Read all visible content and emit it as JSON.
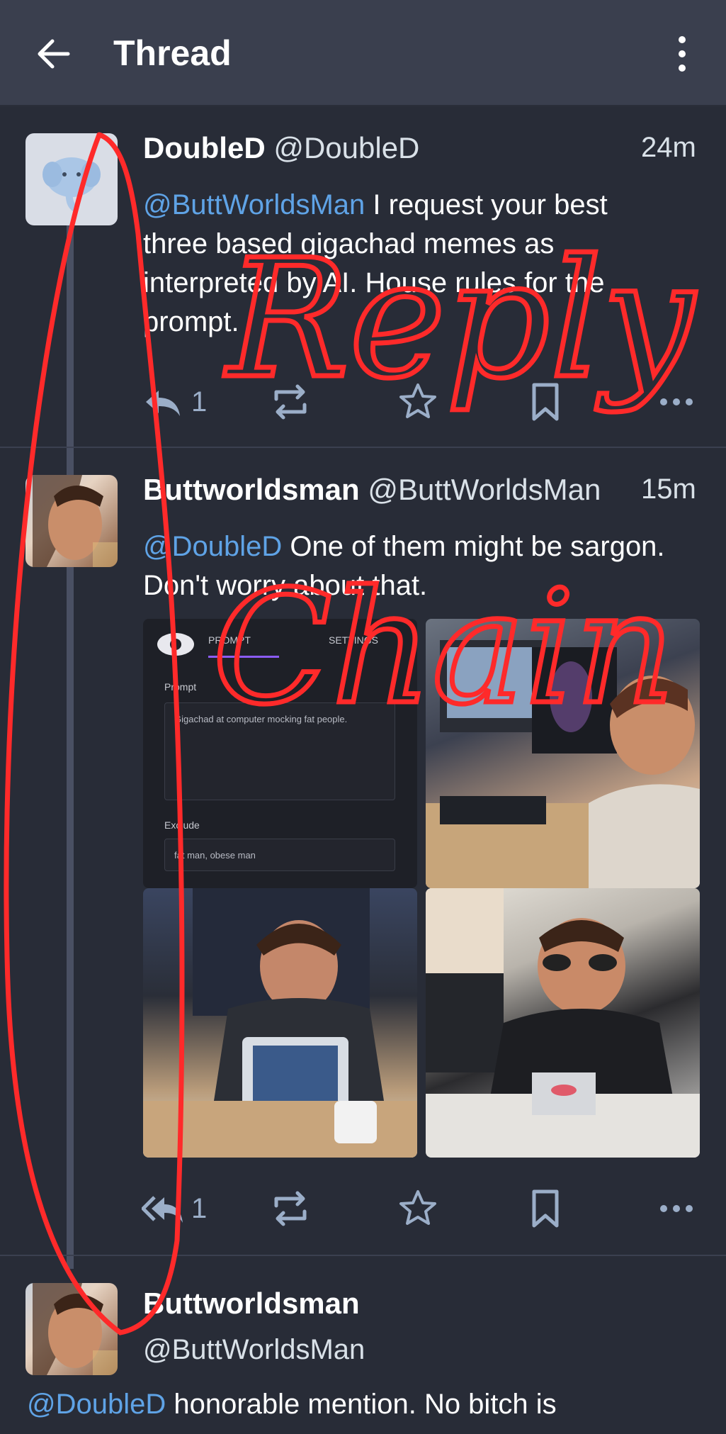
{
  "header": {
    "title": "Thread",
    "back_icon": "arrow-left-icon",
    "menu_icon": "more-vertical-icon"
  },
  "posts": [
    {
      "author_name": "DoubleD",
      "author_handle": "@DoubleD",
      "time": "24m",
      "mention": "@ButtWorldsMan",
      "text_lines": [
        " I request your best",
        "three based gigachad memes as",
        "interpreted by AI. House rules for the",
        "prompt."
      ],
      "reply_count": "1"
    },
    {
      "author_name": "Buttworldsman",
      "author_handle": "@ButtWorldsMan",
      "time": "15m",
      "mention": "@DoubleD",
      "text_lines": [
        " One of them might be sargon.",
        "Don't worry about that."
      ],
      "reply_count": "1",
      "media": {
        "ui_tab_prompt": "PROMPT",
        "ui_tab_settings": "SETTINGS",
        "ui_prompt_label": "Prompt",
        "ui_prompt_text": "Gigachad at computer mocking fat people.",
        "ui_exclude_label": "Exclude",
        "ui_exclude_text": "fat man, obese man"
      }
    },
    {
      "author_name": "Buttworldsman",
      "author_handle": "@ButtWorldsMan",
      "mention": "@DoubleD",
      "text": " honorable mention. No bitch is"
    }
  ],
  "overlay": {
    "word1": "Reply",
    "word2": "Chain",
    "color": "#ff2a2a"
  },
  "colors": {
    "background": "#282c37",
    "header": "#3a3f4e",
    "mention": "#5fa3e6",
    "icon": "#9baec8"
  }
}
